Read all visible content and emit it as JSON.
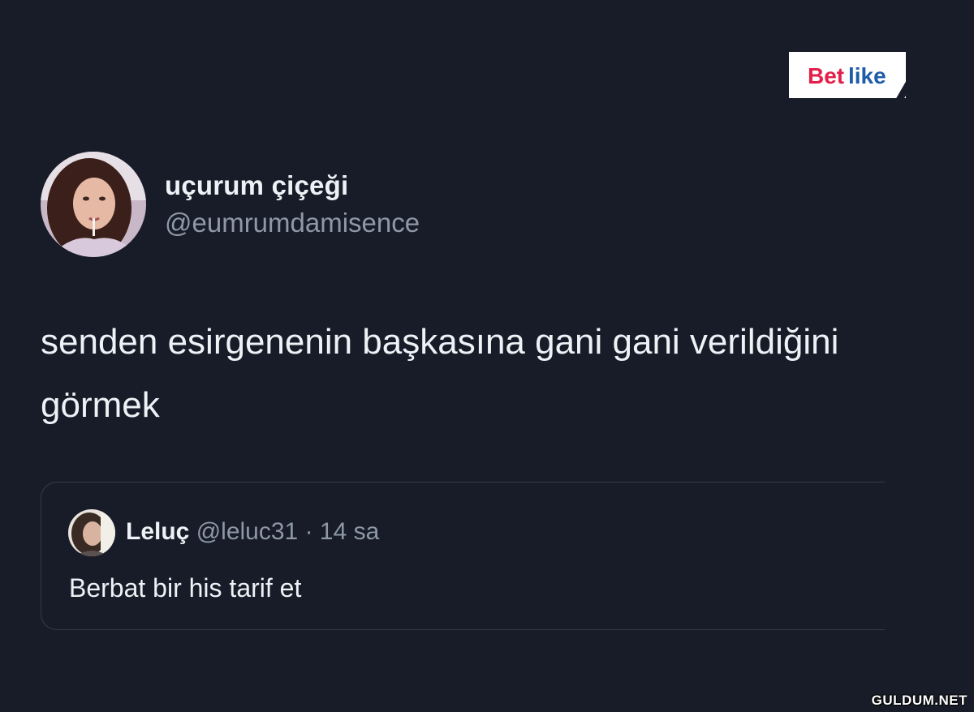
{
  "brand": {
    "logo_text": "Betlike",
    "accent_color": "#e2204a"
  },
  "tweet": {
    "author_name": "uçurum çiçeği",
    "author_handle": "@eumrumdamisence",
    "text": "senden esirgenenin başkasına gani gani verildiğini görmek"
  },
  "quoted_tweet": {
    "author_name": "Leluç",
    "author_handle": "@leluc31",
    "separator": "·",
    "time": "14 sa",
    "text": "Berbat bir his tarif et"
  },
  "watermark": "GULDUM.NET",
  "colors": {
    "background": "#171c28",
    "primary_text": "#eef1f5",
    "secondary_text": "#8e98a7",
    "card_border": "#333c4c"
  }
}
